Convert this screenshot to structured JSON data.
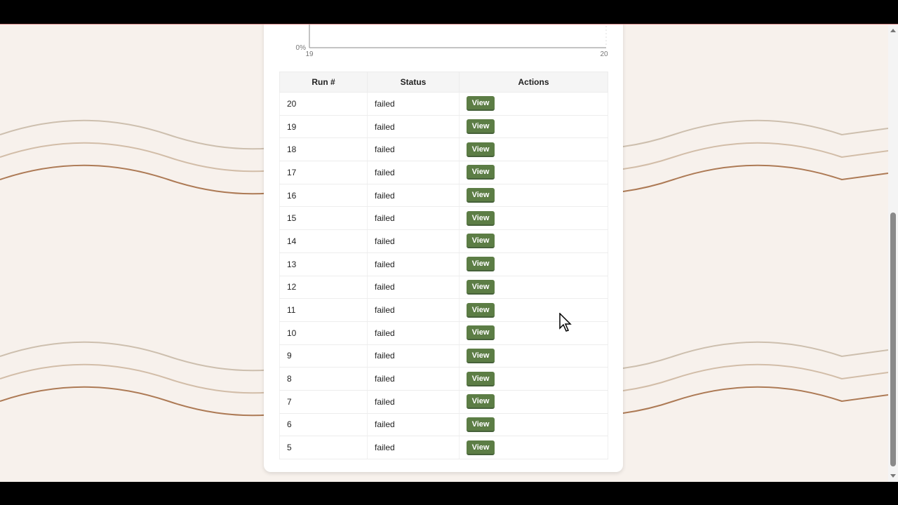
{
  "chart": {
    "y_tick_label": "0%",
    "x_tick_labels": [
      "19",
      "20"
    ]
  },
  "table": {
    "headers": [
      "Run #",
      "Status",
      "Actions"
    ],
    "rows": [
      {
        "run": "20",
        "status": "failed",
        "action": "View"
      },
      {
        "run": "19",
        "status": "failed",
        "action": "View"
      },
      {
        "run": "18",
        "status": "failed",
        "action": "View"
      },
      {
        "run": "17",
        "status": "failed",
        "action": "View"
      },
      {
        "run": "16",
        "status": "failed",
        "action": "View"
      },
      {
        "run": "15",
        "status": "failed",
        "action": "View"
      },
      {
        "run": "14",
        "status": "failed",
        "action": "View"
      },
      {
        "run": "13",
        "status": "failed",
        "action": "View"
      },
      {
        "run": "12",
        "status": "failed",
        "action": "View"
      },
      {
        "run": "11",
        "status": "failed",
        "action": "View"
      },
      {
        "run": "10",
        "status": "failed",
        "action": "View"
      },
      {
        "run": "9",
        "status": "failed",
        "action": "View"
      },
      {
        "run": "8",
        "status": "failed",
        "action": "View"
      },
      {
        "run": "7",
        "status": "failed",
        "action": "View"
      },
      {
        "run": "6",
        "status": "failed",
        "action": "View"
      },
      {
        "run": "5",
        "status": "failed",
        "action": "View"
      }
    ]
  },
  "colors": {
    "page_background": "#f7f1ec",
    "view_button": "#5c7d45",
    "wave_light": "#c9b8a6",
    "wave_dark": "#a8754f"
  },
  "icons": {
    "cursor": "mouse-pointer-icon",
    "scroll_up": "scroll-up-arrow-icon",
    "scroll_down": "scroll-down-arrow-icon"
  }
}
